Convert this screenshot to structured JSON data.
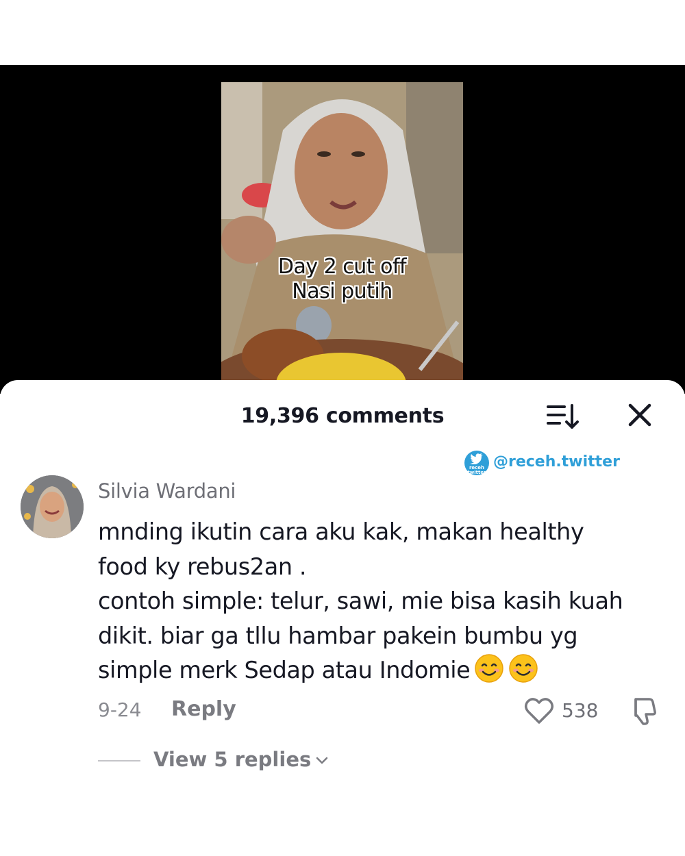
{
  "video": {
    "caption_line1": "Day 2 cut off",
    "caption_line2": "Nasi putih"
  },
  "comments_panel": {
    "title": "19,396 comments",
    "sort_icon": "sort-icon",
    "close_icon": "close-icon"
  },
  "watermark": {
    "logo_text": "receh twitter",
    "handle": "@receh.twitter"
  },
  "comment": {
    "username": "Silvia Wardani",
    "lines": [
      "mnding ikutin cara aku kak, makan healthy",
      "food ky rebus2an .",
      "contoh simple: telur, sawi, mie bisa kasih kuah",
      "dikit. biar ga tllu hambar pakein bumbu yg",
      "simple merk Sedap atau Indomie"
    ],
    "date": "9-24",
    "reply_label": "Reply",
    "likes": "538",
    "view_replies": "View 5 replies"
  },
  "colors": {
    "primary_text": "#161823",
    "secondary_text": "#6e6f76",
    "watermark_blue": "#2f9fd8"
  }
}
